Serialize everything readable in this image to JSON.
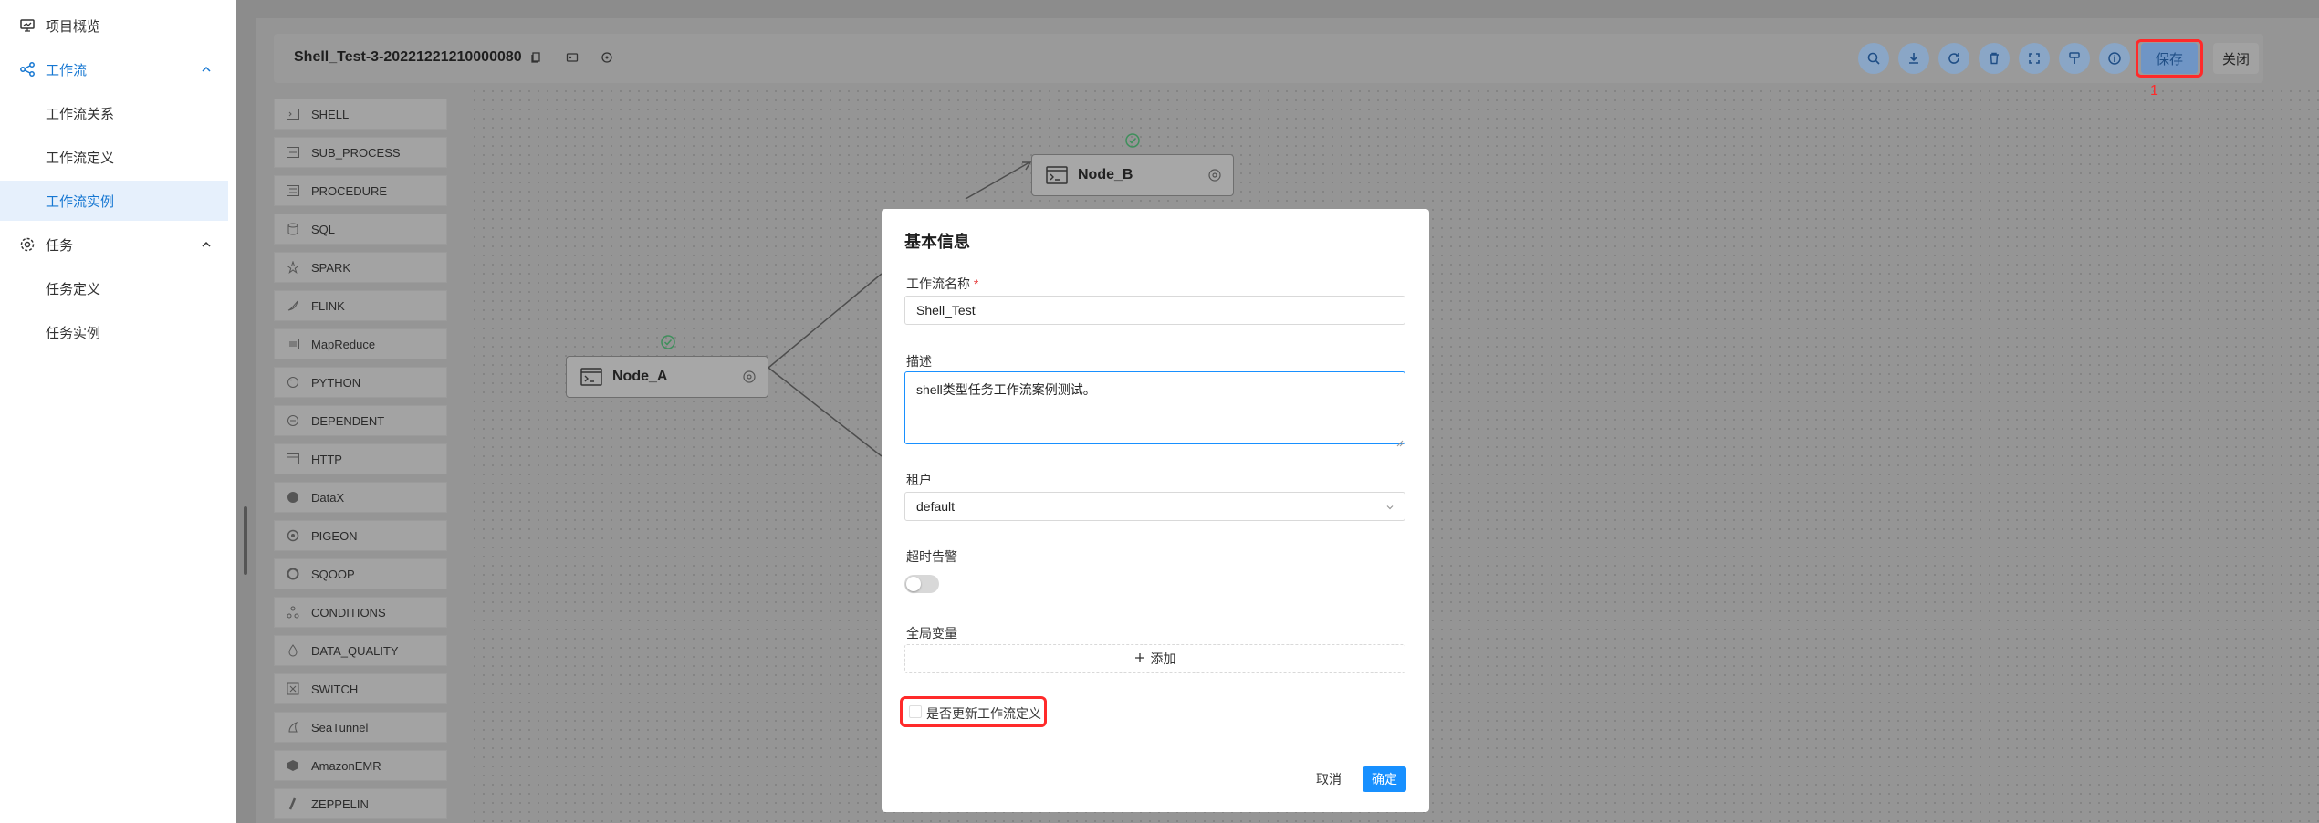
{
  "sidebar": {
    "items": [
      {
        "label": "项目概览",
        "icon": "monitor-icon"
      },
      {
        "label": "工作流",
        "icon": "workflow-icon",
        "expanded": true
      },
      {
        "label": "工作流关系"
      },
      {
        "label": "工作流定义"
      },
      {
        "label": "工作流实例",
        "active": true
      },
      {
        "label": "任务",
        "icon": "gear-icon",
        "expanded": true
      },
      {
        "label": "任务定义"
      },
      {
        "label": "任务实例"
      }
    ]
  },
  "toolbar": {
    "workflow_title": "Shell_Test-3-20221221210000080",
    "save_label": "保存",
    "close_label": "关闭",
    "annotation_number": "1",
    "icons": [
      "search-icon",
      "download-icon",
      "refresh-icon",
      "delete-icon",
      "fullscreen-icon",
      "format-icon",
      "info-icon"
    ]
  },
  "tasks": [
    {
      "label": "SHELL",
      "icon": "terminal-icon"
    },
    {
      "label": "SUB_PROCESS",
      "icon": "subprocess-icon"
    },
    {
      "label": "PROCEDURE",
      "icon": "procedure-icon"
    },
    {
      "label": "SQL",
      "icon": "database-icon"
    },
    {
      "label": "SPARK",
      "icon": "spark-icon"
    },
    {
      "label": "FLINK",
      "icon": "flink-icon"
    },
    {
      "label": "MapReduce",
      "icon": "mapreduce-icon"
    },
    {
      "label": "PYTHON",
      "icon": "python-icon"
    },
    {
      "label": "DEPENDENT",
      "icon": "dependent-icon"
    },
    {
      "label": "HTTP",
      "icon": "http-icon"
    },
    {
      "label": "DataX",
      "icon": "datax-icon"
    },
    {
      "label": "PIGEON",
      "icon": "pigeon-icon"
    },
    {
      "label": "SQOOP",
      "icon": "sqoop-icon"
    },
    {
      "label": "CONDITIONS",
      "icon": "conditions-icon"
    },
    {
      "label": "DATA_QUALITY",
      "icon": "data-quality-icon"
    },
    {
      "label": "SWITCH",
      "icon": "switch-icon"
    },
    {
      "label": "SeaTunnel",
      "icon": "seatunnel-icon"
    },
    {
      "label": "AmazonEMR",
      "icon": "amazon-emr-icon"
    },
    {
      "label": "ZEPPELIN",
      "icon": "zeppelin-icon"
    }
  ],
  "canvas": {
    "nodes": [
      {
        "label": "Node_A"
      },
      {
        "label": "Node_B"
      }
    ]
  },
  "modal": {
    "title": "基本信息",
    "name_label": "工作流名称",
    "required_mark": "*",
    "name_value": "Shell_Test",
    "desc_label": "描述",
    "desc_value": "shell类型任务工作流案例测试。",
    "tenant_label": "租户",
    "tenant_value": "default",
    "timeout_label": "超时告警",
    "timeout_enabled": false,
    "global_vars_label": "全局变量",
    "add_label": "添加",
    "update_def_label": "是否更新工作流定义",
    "update_def_checked": false,
    "cancel_label": "取消",
    "ok_label": "确定"
  },
  "colors": {
    "accent": "#1890ff",
    "annotation": "#ff2a2a",
    "active_nav": "#1677d2"
  }
}
